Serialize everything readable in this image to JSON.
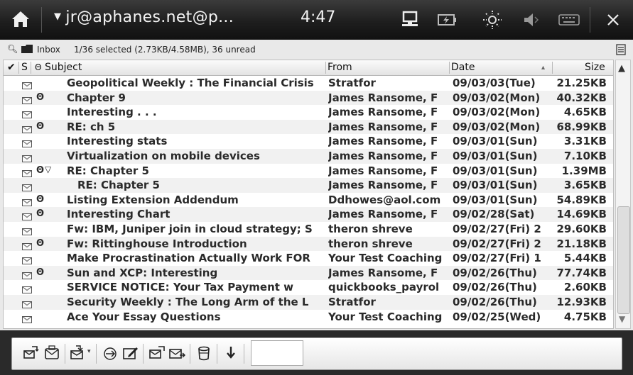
{
  "topbar": {
    "account": "jr@aphanes.net@p...",
    "time": "4:47",
    "icons": [
      "home-icon",
      "network-icon",
      "battery-icon",
      "brightness-icon",
      "volume-icon",
      "keyboard-icon",
      "close-icon"
    ]
  },
  "status": {
    "folder": "Inbox",
    "info": "1/36 selected (2.73KB/4.58MB), 36 unread"
  },
  "columns": {
    "check": "✔",
    "status": "S",
    "attach": "Θ",
    "subject": "Subject",
    "from": "From",
    "date": "Date",
    "sort_indicator": "▴",
    "size": "Size"
  },
  "messages": [
    {
      "subject": "Geopolitical Weekly : The Financial Crisis",
      "from": "Stratfor",
      "date": "09/03/03(Tue)",
      "size": "21.25KB",
      "attach": "",
      "thread": ""
    },
    {
      "subject": "Chapter 9",
      "from": "James Ransome, F",
      "date": "09/03/02(Mon)",
      "size": "40.32KB",
      "attach": "Θ",
      "thread": ""
    },
    {
      "subject": "Interesting . . .",
      "from": "James Ransome, F",
      "date": "09/03/02(Mon)",
      "size": "4.65KB",
      "attach": "",
      "thread": ""
    },
    {
      "subject": "RE: ch 5",
      "from": "James Ransome, F",
      "date": "09/03/02(Mon)",
      "size": "68.99KB",
      "attach": "Θ",
      "thread": ""
    },
    {
      "subject": "Interesting stats",
      "from": "James Ransome, F",
      "date": "09/03/01(Sun)",
      "size": "3.31KB",
      "attach": "",
      "thread": ""
    },
    {
      "subject": "Virtualization on mobile devices",
      "from": "James Ransome, F",
      "date": "09/03/01(Sun)",
      "size": "7.10KB",
      "attach": "",
      "thread": ""
    },
    {
      "subject": "RE: Chapter 5",
      "from": "James Ransome, F",
      "date": "09/03/01(Sun)",
      "size": "1.39MB",
      "attach": "Θ",
      "thread": "▽"
    },
    {
      "subject": "RE: Chapter 5",
      "from": "James Ransome, F",
      "date": "09/03/01(Sun)",
      "size": "3.65KB",
      "attach": "",
      "thread": "",
      "child": true
    },
    {
      "subject": "Listing Extension Addendum",
      "from": "Ddhowes@aol.com",
      "date": "09/03/01(Sun)",
      "size": "54.89KB",
      "attach": "Θ",
      "thread": ""
    },
    {
      "subject": "Interesting Chart",
      "from": "James Ransome, F",
      "date": "09/02/28(Sat)",
      "size": "14.69KB",
      "attach": "Θ",
      "thread": ""
    },
    {
      "subject": "Fw: IBM, Juniper join in cloud strategy; S",
      "from": "theron shreve",
      "date": "09/02/27(Fri) 2",
      "size": "29.60KB",
      "attach": "",
      "thread": ""
    },
    {
      "subject": "Fw: Rittinghouse Introduction",
      "from": "theron shreve",
      "date": "09/02/27(Fri) 2",
      "size": "21.18KB",
      "attach": "Θ",
      "thread": ""
    },
    {
      "subject": "Make Procrastination Actually Work FOR",
      "from": "Your Test Coaching",
      "date": "09/02/27(Fri) 1",
      "size": "5.44KB",
      "attach": "",
      "thread": ""
    },
    {
      "subject": "Sun and XCP: Interesting",
      "from": "James Ransome, F",
      "date": "09/02/26(Thu)",
      "size": "77.74KB",
      "attach": "Θ",
      "thread": ""
    },
    {
      "subject": "SERVICE NOTICE:  Your Tax Payment w",
      "from": "quickbooks_payrol",
      "date": "09/02/26(Thu)",
      "size": "2.60KB",
      "attach": "",
      "thread": ""
    },
    {
      "subject": "Security Weekly : The Long Arm of the L",
      "from": "Stratfor",
      "date": "09/02/26(Thu)",
      "size": "12.93KB",
      "attach": "",
      "thread": ""
    },
    {
      "subject": "Ace Your Essay Questions",
      "from": "Your Test Coaching",
      "date": "09/02/25(Wed)",
      "size": "4.75KB",
      "attach": "",
      "thread": ""
    }
  ],
  "toolbar": {
    "buttons": [
      "get-mail-icon",
      "compose-icon",
      "reply-icon",
      "forward-icon",
      "edit-icon",
      "send-icon",
      "send-receive-icon",
      "delete-icon",
      "next-icon"
    ],
    "search_value": ""
  }
}
